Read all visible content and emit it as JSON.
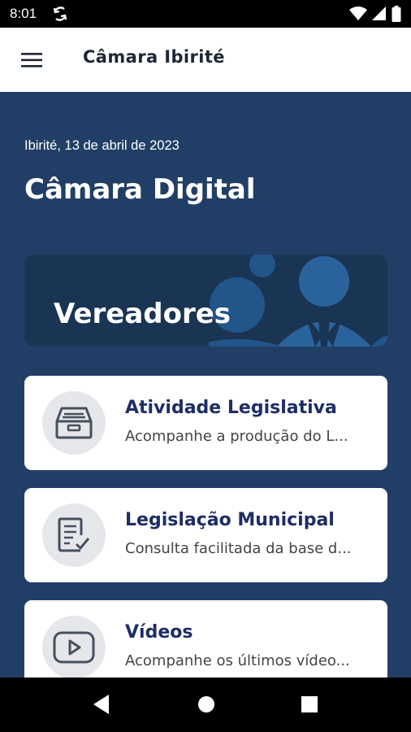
{
  "status_bar": {
    "time": "8:01",
    "icons": [
      "sync-icon",
      "wifi-icon",
      "signal-icon",
      "battery-icon"
    ]
  },
  "app_bar": {
    "title": "Câmara Ibirité",
    "menu_icon": "hamburger-menu-icon"
  },
  "main": {
    "date_line": "Ibirité, 13 de abril de 2023",
    "title": "Câmara Digital",
    "banner": {
      "label": "Vereadores"
    },
    "cards": [
      {
        "title": "Atividade Legislativa",
        "subtitle": "Acompanhe a produção do L...",
        "icon": "inbox-tray-icon"
      },
      {
        "title": "Legislação Municipal",
        "subtitle": "Consulta facilitada da base d...",
        "icon": "document-check-icon"
      },
      {
        "title": "Vídeos",
        "subtitle": "Acompanhe os últimos vídeo...",
        "icon": "youtube-play-icon"
      }
    ]
  },
  "nav_bar": {
    "buttons": [
      "back-icon",
      "home-icon",
      "recents-icon"
    ]
  },
  "colors": {
    "background": "#213f66",
    "banner": "#1a3554",
    "card_title": "#1e2d66",
    "card_icon_circle": "#e6e7ea"
  }
}
